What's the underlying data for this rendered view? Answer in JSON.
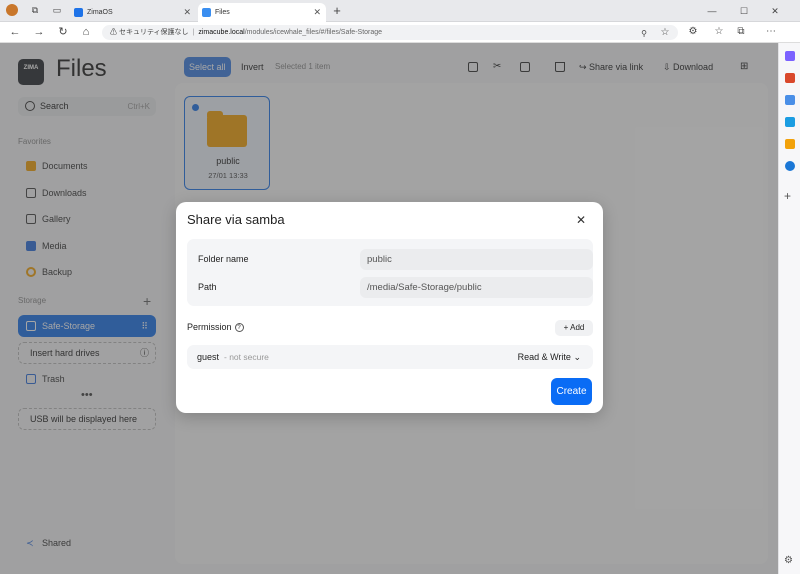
{
  "browser": {
    "tabs": [
      {
        "label": "ZimaOS"
      },
      {
        "label": "Files"
      }
    ],
    "security": "セキュリティ保護なし",
    "url_host": "zimacube.local",
    "url_path": "/modules/icewhale_files/#/files/Safe-Storage"
  },
  "app": {
    "logo": "ZIMA",
    "title": "Files",
    "search": {
      "label": "Search",
      "shortcut": "Ctrl+K"
    },
    "favorites_label": "Favorites",
    "favorites": [
      {
        "label": "Documents"
      },
      {
        "label": "Downloads"
      },
      {
        "label": "Gallery"
      },
      {
        "label": "Media"
      },
      {
        "label": "Backup"
      }
    ],
    "storage_label": "Storage",
    "storage_active": "Safe-Storage",
    "insert": "Insert hard drives",
    "trash": "Trash",
    "usb": "USB will be displayed here",
    "shared": "Shared"
  },
  "toolbar": {
    "select_all": "Select all",
    "invert": "Invert",
    "selected": "Selected 1 item",
    "share": "Share via link",
    "download": "Download"
  },
  "files": [
    {
      "name": "public",
      "date": "27/01 13:33"
    }
  ],
  "modal": {
    "title": "Share via samba",
    "folder_label": "Folder name",
    "folder_value": "public",
    "path_label": "Path",
    "path_value": "/media/Safe-Storage/public",
    "permission": "Permission",
    "add": "Add",
    "user": "guest",
    "user_note": "- not secure",
    "access": "Read & Write",
    "create": "Create"
  },
  "colors": {
    "accent": "#1e73e8",
    "folder": "#f2a20c",
    "create": "#0a6cf5"
  }
}
